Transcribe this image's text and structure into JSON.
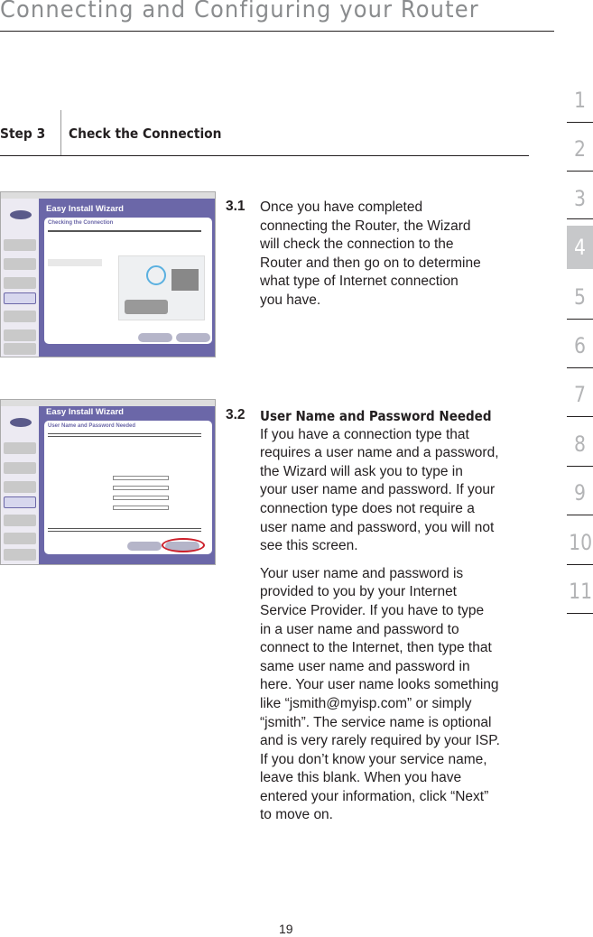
{
  "header": {
    "title": "Connecting and Configuring your Router",
    "step": "Step 3",
    "step_title": "Check the Connection"
  },
  "sections": [
    {
      "number": "3.1",
      "lines": [
        "Once you have completed",
        "connecting the Router, the Wizard",
        "will check the connection to the",
        "Router and then go on to determine",
        "what type of Internet connection",
        "you have."
      ],
      "screenshot": {
        "app_title": "Easy Install Wizard",
        "screen_title": "Checking the Connection"
      }
    },
    {
      "number": "3.2",
      "heading": "User Name and Password Needed",
      "lines": [
        "If you have a connection type that",
        "requires a user name and a password,",
        "the Wizard will ask you to type in",
        "your user name and password. If your",
        "connection type does not require a",
        "user name and password, you will not",
        "see this screen."
      ],
      "lines2": [
        "Your user name and password is",
        "provided to you by your Internet",
        "Service Provider. If you have to type",
        "in a user name and password to",
        "connect to the Internet, then type that",
        "same user name and password in",
        "here. Your user name looks something",
        "like “jsmith@myisp.com” or simply",
        "“jsmith”. The service name is optional",
        "and is very rarely required by your ISP.",
        "If you don’t know your service name,",
        "leave this blank. When you have",
        "entered your information, click “Next”",
        "to move on."
      ],
      "screenshot": {
        "app_title": "Easy Install Wizard",
        "screen_title": "User Name and Password Needed",
        "highlight_color": "#cc1f2a"
      }
    }
  ],
  "chapter_nav": {
    "items": [
      "1",
      "2",
      "3",
      "4",
      "5",
      "6",
      "7",
      "8",
      "9",
      "10",
      "11"
    ],
    "active": "4"
  },
  "page_number": "19"
}
